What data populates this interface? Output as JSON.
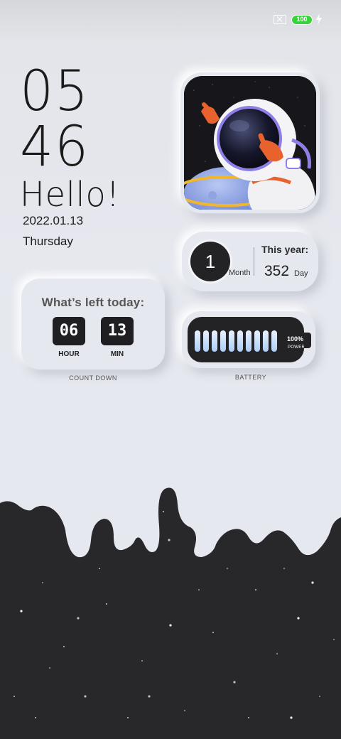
{
  "status_bar": {
    "sim_icon": "no-sim-icon",
    "battery_level": "100",
    "charging_icon": "lightning-bolt-icon",
    "battery_color": "#3ad23a"
  },
  "clock": {
    "hours": "05",
    "minutes": "46",
    "greeting": "Hello!",
    "date": "2022.01.13",
    "weekday": "Thursday"
  },
  "astronaut_widget": {
    "image": "astronaut-illustration"
  },
  "year_widget": {
    "month_value": "1",
    "month_label": "Month",
    "title": "This year:",
    "days_value": "352",
    "days_label": "Day"
  },
  "countdown_widget": {
    "title": "What’s left today:",
    "hours": "06",
    "hours_label": "HOUR",
    "minutes": "13",
    "minutes_label": "MIN",
    "caption": "COUNT DOWN"
  },
  "battery_widget": {
    "level": 1.0,
    "cells": 10,
    "percent_label": "100%",
    "power_label": "POWER",
    "caption": "BATTERY",
    "cell_color": "#b8d6fb"
  },
  "colors": {
    "background": "#e6e8ef",
    "dark": "#232326",
    "wallpaper_bottom": "#28282b"
  }
}
